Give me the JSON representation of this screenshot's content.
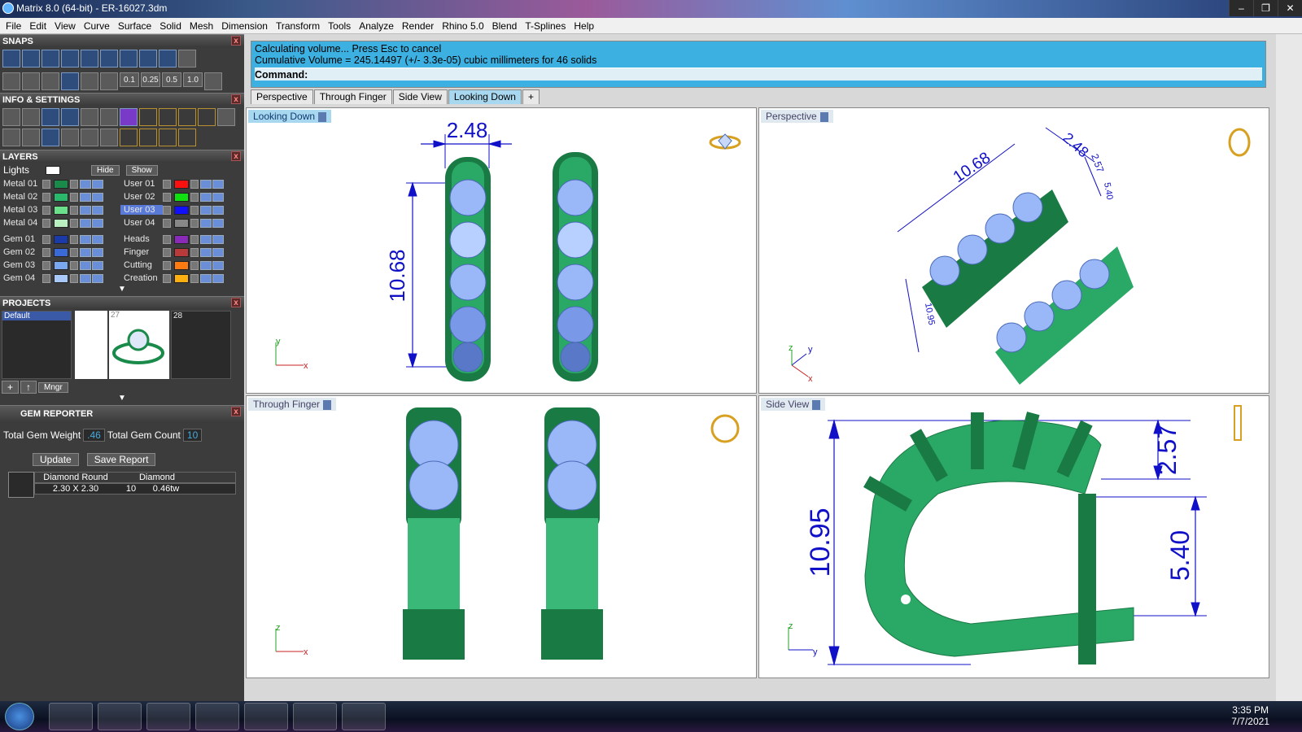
{
  "window": {
    "title": "Matrix 8.0 (64-bit) - ER-16027.3dm"
  },
  "menu": [
    "File",
    "Edit",
    "View",
    "Curve",
    "Surface",
    "Solid",
    "Mesh",
    "Dimension",
    "Transform",
    "Tools",
    "Analyze",
    "Render",
    "Rhino 5.0",
    "Blend",
    "T-Splines",
    "Help"
  ],
  "panels": {
    "snaps": "SNAPS",
    "info": "INFO & SETTINGS",
    "layers": "LAYERS",
    "projects": "PROJECTS",
    "gem_reporter": "GEM REPORTER"
  },
  "snap_values": [
    "0.1",
    "0.25",
    "0.5",
    "1.0"
  ],
  "layers": {
    "lights": "Lights",
    "hide": "Hide",
    "show": "Show",
    "left": [
      {
        "name": "Metal 01",
        "color": "#1a8a4a"
      },
      {
        "name": "Metal 02",
        "color": "#2ab86a"
      },
      {
        "name": "Metal 03",
        "color": "#6ae08a"
      },
      {
        "name": "Metal 04",
        "color": "#b8f0c0"
      },
      {
        "name": "Gem 01",
        "color": "#1a3aa8"
      },
      {
        "name": "Gem 02",
        "color": "#3a6ad8"
      },
      {
        "name": "Gem 03",
        "color": "#7aa8f0"
      },
      {
        "name": "Gem 04",
        "color": "#a8c8f8"
      }
    ],
    "right": [
      {
        "name": "User 01",
        "color": "#ff1010"
      },
      {
        "name": "User 02",
        "color": "#10e010"
      },
      {
        "name": "User 03",
        "color": "#1010ff",
        "selected": true
      },
      {
        "name": "User 04",
        "color": "#888888"
      },
      {
        "name": "Heads",
        "color": "#8a2ab8"
      },
      {
        "name": "Finger",
        "color": "#b83a3a"
      },
      {
        "name": "Cutting",
        "color": "#ff7a10"
      },
      {
        "name": "Creation",
        "color": "#ffb010"
      }
    ]
  },
  "projects": {
    "default": "Default",
    "ids": [
      "27",
      "28"
    ],
    "mngr": "Mngr"
  },
  "gem_reporter": {
    "total_weight_label": "Total Gem Weight",
    "total_weight": ".46",
    "total_count_label": "Total Gem Count",
    "total_count": "10",
    "update": "Update",
    "save_report": "Save Report",
    "col1": "Diamond Round",
    "col2": "Diamond",
    "size": "2.30 X 2.30",
    "qty": "10",
    "tw": "0.46tw"
  },
  "command": {
    "line1": "Calculating volume... Press Esc to cancel",
    "line2": "Cumulative Volume = 245.14497 (+/- 3.3e-05) cubic millimeters for 46 solids",
    "prompt": "Command:"
  },
  "tabs": [
    "Perspective",
    "Through Finger",
    "Side View",
    "Looking Down"
  ],
  "viewports": {
    "looking_down": {
      "label": "Looking Down",
      "dim_w": "2.48",
      "dim_h": "10.68"
    },
    "perspective": {
      "label": "Perspective",
      "dim_a": "10.68",
      "dim_b": "2.48",
      "dim_c": "2.57",
      "dim_d": "10.95",
      "dim_e": "5.40"
    },
    "through_finger": {
      "label": "Through Finger"
    },
    "side_view": {
      "label": "Side View",
      "dim_h": "10.95",
      "dim_top": "2.57",
      "dim_bot": "5.40"
    }
  },
  "axes": {
    "x": "x",
    "y": "y",
    "z": "z"
  },
  "clock": {
    "time": "3:35 PM",
    "date": "7/7/2021"
  },
  "colors": {
    "metal": "#1a8a4a",
    "gem": "#9ab8f8",
    "dimension": "#1010c8"
  }
}
